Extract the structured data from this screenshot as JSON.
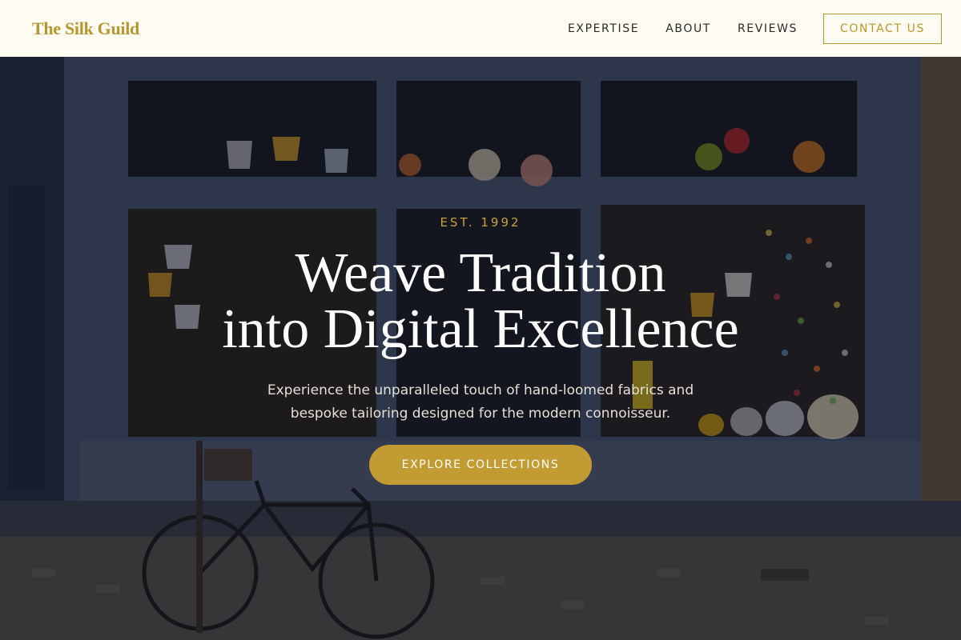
{
  "header": {
    "brand": "The Silk Guild",
    "nav": [
      "EXPERTISE",
      "ABOUT",
      "REVIEWS"
    ],
    "contact_label": "CONTACT US"
  },
  "hero": {
    "eyebrow": "EST. 1992",
    "headline_line1": "Weave Tradition",
    "headline_line2": "into Digital Excellence",
    "subtext_line1": "Experience the unparalleled touch of hand-loomed fabrics and",
    "subtext_line2": "bespoke tailoring designed for the modern connoisseur.",
    "cta_label": "EXPLORE COLLECTIONS"
  },
  "colors": {
    "accent": "#c29b32",
    "header_bg": "#fffdf3",
    "brand_text": "#b8962e"
  }
}
